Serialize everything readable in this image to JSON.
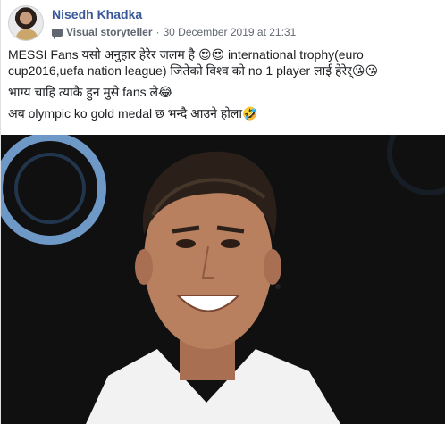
{
  "post": {
    "author": "Nisedh Khadka",
    "badge_icon": "speech-bubble-icon",
    "role": "Visual storyteller",
    "separator": "·",
    "date": "30 December 2019 at 21:31",
    "privacy_icon": "globe-icon",
    "lines": [
      "MESSI Fans यसो अनुहार हेरेर जलम है 😍😍 international trophy(euro cup2016,uefa nation league) जितेको विश्व को no 1 player लाई हेरेर्😘😘",
      "भाग्य चाहि त्याकै हुन मुसे fans ले😂",
      "अब olympic ko gold medal छ भन्दै आउने होला🤣"
    ]
  },
  "photo": {
    "background_color": "#101010",
    "ring_color": "#7fb2e8",
    "skin_color": "#b9805f",
    "jacket_color": "#f2f2f2"
  }
}
